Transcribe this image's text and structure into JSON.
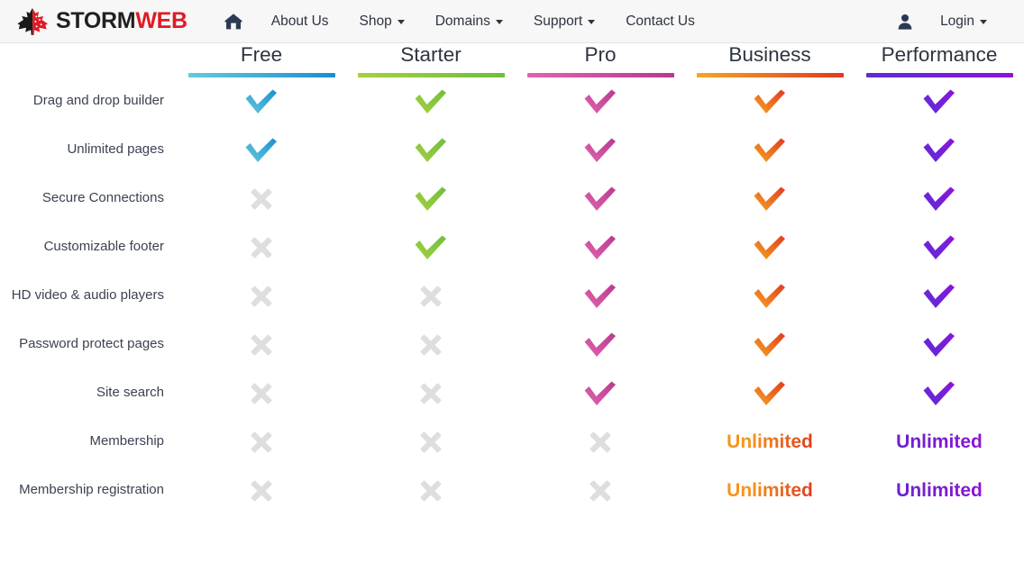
{
  "navbar": {
    "brand": {
      "part1": "STORM",
      "part2": "WEB",
      "leaf_icon": "maple-leaf-icon"
    },
    "home_icon": "home-icon",
    "links": [
      {
        "label": "About Us",
        "has_caret": false
      },
      {
        "label": "Shop",
        "has_caret": true
      },
      {
        "label": "Domains",
        "has_caret": true
      },
      {
        "label": "Support",
        "has_caret": true
      },
      {
        "label": "Contact Us",
        "has_caret": false
      }
    ],
    "account": {
      "icon": "user-icon",
      "label": "Login",
      "has_caret": true
    }
  },
  "comparison": {
    "plans": [
      {
        "name": "Free",
        "accent_from": "#63cbd9",
        "accent_to": "#1b8ed2"
      },
      {
        "name": "Starter",
        "accent_from": "#a5d13c",
        "accent_to": "#6dbe3f"
      },
      {
        "name": "Pro",
        "accent_from": "#e264b0",
        "accent_to": "#b8398e"
      },
      {
        "name": "Business",
        "accent_from": "#f6a623",
        "accent_to": "#e03a1f"
      },
      {
        "name": "Performance",
        "accent_from": "#5a2ed6",
        "accent_to": "#8e13da"
      }
    ],
    "cross_color": "#dedede",
    "rows": [
      {
        "feature": "Drag and drop builder",
        "values": [
          "check",
          "check",
          "check",
          "check",
          "check"
        ]
      },
      {
        "feature": "Unlimited pages",
        "values": [
          "check",
          "check",
          "check",
          "check",
          "check"
        ]
      },
      {
        "feature": "Secure Connections",
        "values": [
          "cross",
          "check",
          "check",
          "check",
          "check"
        ]
      },
      {
        "feature": "Customizable footer",
        "values": [
          "cross",
          "check",
          "check",
          "check",
          "check"
        ]
      },
      {
        "feature": "HD video & audio players",
        "values": [
          "cross",
          "cross",
          "check",
          "check",
          "check"
        ]
      },
      {
        "feature": "Password protect pages",
        "values": [
          "cross",
          "cross",
          "check",
          "check",
          "check"
        ]
      },
      {
        "feature": "Site search",
        "values": [
          "cross",
          "cross",
          "check",
          "check",
          "check"
        ]
      },
      {
        "feature": "Membership",
        "values": [
          "cross",
          "cross",
          "cross",
          "Unlimited",
          "Unlimited"
        ]
      },
      {
        "feature": "Membership registration",
        "values": [
          "cross",
          "cross",
          "cross",
          "Unlimited",
          "Unlimited"
        ]
      }
    ]
  }
}
